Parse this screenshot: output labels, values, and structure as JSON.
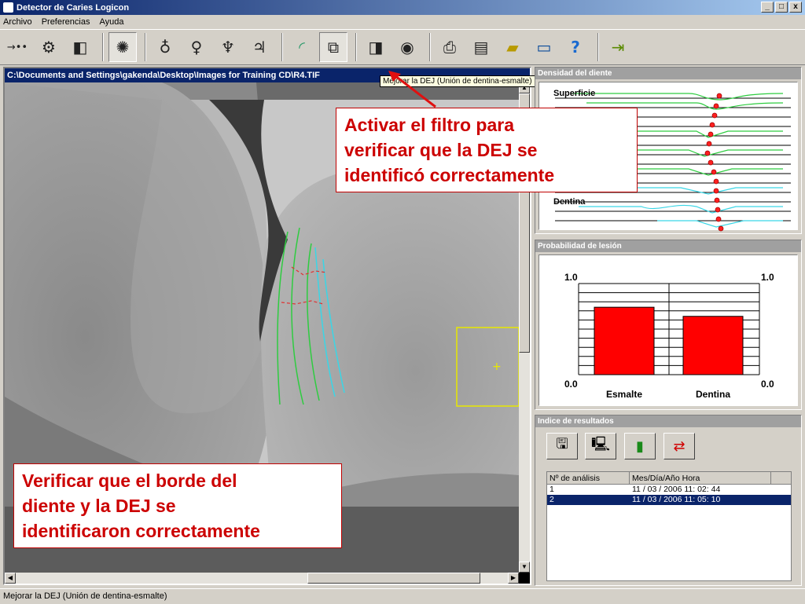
{
  "window": {
    "title": "Detector de Caries Logicon",
    "min": "_",
    "max": "□",
    "close": "x"
  },
  "menu": [
    "Archivo",
    "Preferencias",
    "Ayuda"
  ],
  "toolbar": {
    "icons": [
      "arrows-icon",
      "tooth-probe-icon",
      "compare-icon",
      "enhance-icon",
      "tooth-1-icon",
      "tooth-2-icon",
      "tooth-3-icon",
      "tooth-4-icon",
      "dej-filter-icon",
      "dej-enhance-icon",
      "contrast-icon",
      "zoom-eye-icon",
      "printer-icon",
      "clipboard-icon",
      "folder-export-icon",
      "monitor-export-icon",
      "help-icon",
      "exit-icon"
    ]
  },
  "tooltip": "Mejorar la DEJ (Unión de dentina-esmalte)",
  "image_window": {
    "path": "C:\\Documents and Settings\\gakenda\\Desktop\\Images for Training CD\\R4.TIF"
  },
  "density": {
    "title": "Densidad del diente",
    "label_top": "Superficie",
    "label_bottom": "Dentina"
  },
  "probability": {
    "title": "Probabilidad de lesión",
    "ymax_left": "1.0",
    "ymax_right": "1.0",
    "ymin_left": "0.0",
    "ymin_right": "0.0"
  },
  "chart_data": {
    "type": "bar",
    "categories": [
      "Esmalte",
      "Dentina"
    ],
    "values": [
      0.74,
      0.64
    ],
    "ylim": [
      0,
      1
    ],
    "colors": [
      "#ff0000",
      "#ff0000"
    ]
  },
  "results": {
    "title": "Indice de resultados",
    "columns": [
      "Nº de análisis",
      "Mes/Día/Año Hora"
    ],
    "rows": [
      {
        "n": "1",
        "date": "11 / 03 / 2006   11: 02: 44"
      },
      {
        "n": "2",
        "date": "11 / 03 / 2006   11: 05: 10"
      }
    ]
  },
  "callouts": {
    "top": [
      "Activar el filtro para",
      "verificar que la DEJ se",
      "identificó correctamente"
    ],
    "bottom": [
      "Verificar que el borde del",
      "diente y la DEJ se",
      "identificaron correctamente"
    ]
  },
  "status": "Mejorar la DEJ (Unión de dentina-esmalte)"
}
